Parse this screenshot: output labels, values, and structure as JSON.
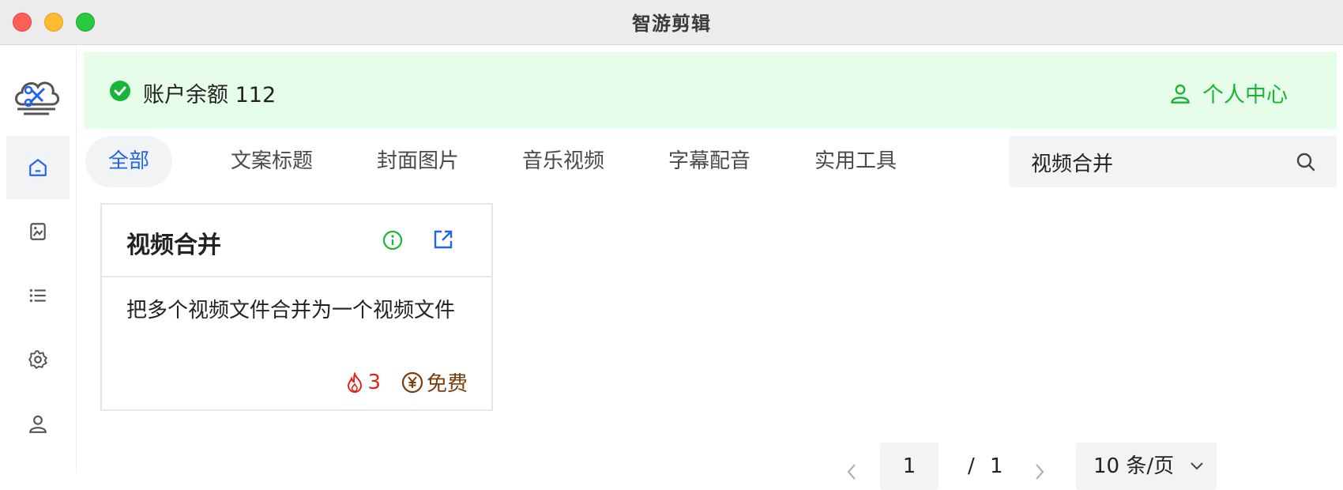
{
  "window": {
    "title": "智游剪辑"
  },
  "sidebar": {
    "items": [
      {
        "name": "home",
        "active": true
      },
      {
        "name": "image"
      },
      {
        "name": "list"
      },
      {
        "name": "settings"
      },
      {
        "name": "user"
      }
    ]
  },
  "balance": {
    "text": "账户余额 112",
    "status_color": "#18b638"
  },
  "header": {
    "personal_center": "个人中心"
  },
  "tabs": [
    {
      "label": "全部",
      "active": true
    },
    {
      "label": "文案标题"
    },
    {
      "label": "封面图片"
    },
    {
      "label": "音乐视频"
    },
    {
      "label": "字幕配音"
    },
    {
      "label": "实用工具"
    }
  ],
  "search": {
    "value": "视频合并"
  },
  "cards": [
    {
      "title": "视频合并",
      "description": "把多个视频文件合并为一个视频文件",
      "hot_count": "3",
      "price": "免费"
    }
  ],
  "pagination": {
    "current": "1",
    "separator": "/",
    "total": "1",
    "page_size": "10 条/页"
  },
  "colors": {
    "accent": "#2164f4",
    "success": "#18b638",
    "hot": "#e5231b"
  }
}
